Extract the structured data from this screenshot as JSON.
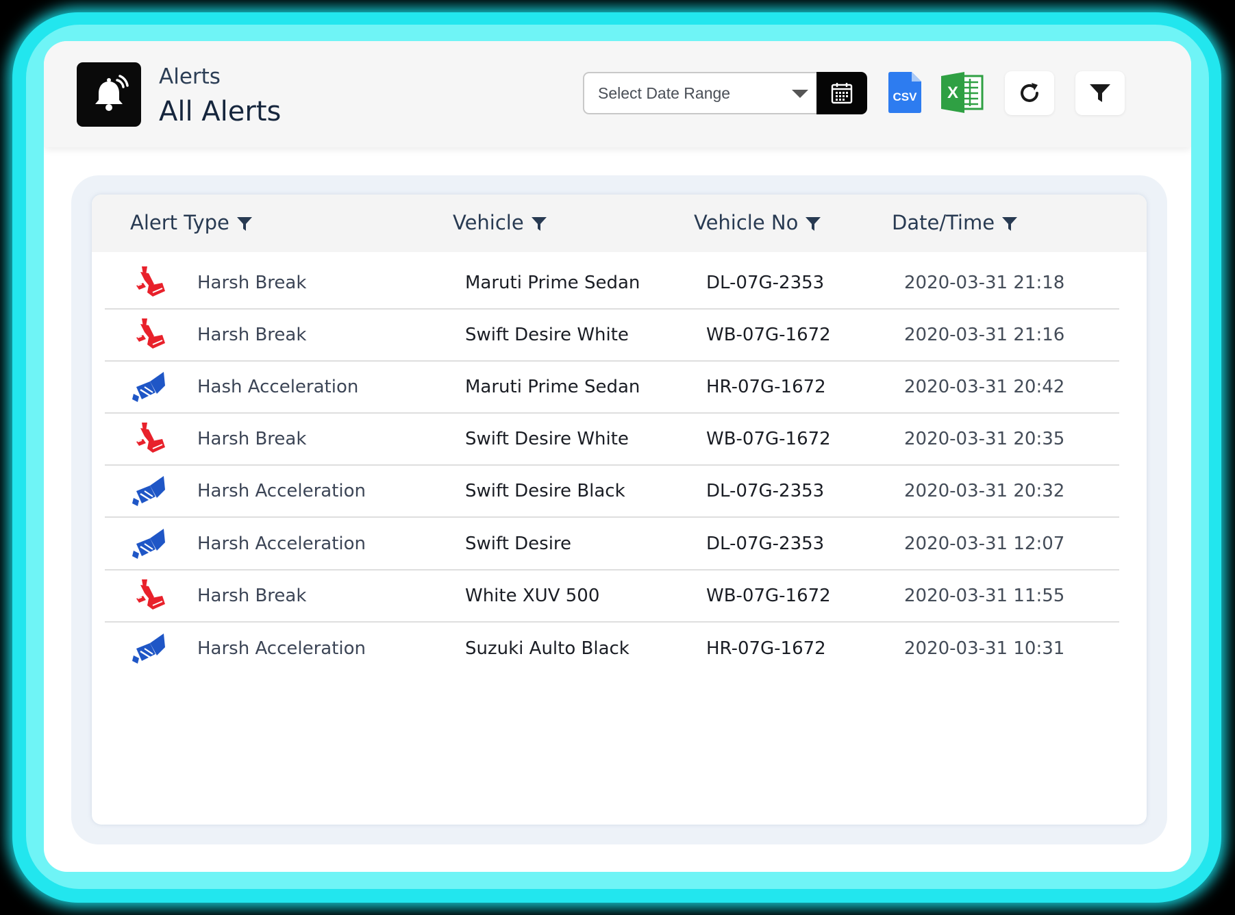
{
  "header": {
    "section_label": "Alerts",
    "page_title": "All Alerts",
    "date_range_placeholder": "Select Date Range",
    "csv_label": "CSV",
    "excel_label": "X"
  },
  "icons": {
    "bell": "bell-ring-icon",
    "calendar": "calendar-icon",
    "csv": "csv-file-icon",
    "excel": "excel-file-icon",
    "refresh": "refresh-icon",
    "filter": "filter-icon",
    "harsh_break": "brake-pedal-icon",
    "harsh_acceleration": "accelerator-pedal-icon"
  },
  "colors": {
    "glow": "#22e6ee",
    "brake_icon": "#e8212b",
    "accel_icon": "#1f56c6",
    "csv_blue": "#2d7cf0",
    "excel_green": "#2fa043"
  },
  "table": {
    "columns": [
      "Alert Type",
      "Vehicle",
      "Vehicle No",
      "Date/Time"
    ],
    "rows": [
      {
        "kind": "brake",
        "type": "Harsh Break",
        "vehicle": "Maruti Prime Sedan",
        "vehicle_no": "DL-07G-2353",
        "datetime": "2020-03-31 21:18"
      },
      {
        "kind": "brake",
        "type": "Harsh Break",
        "vehicle": "Swift Desire White",
        "vehicle_no": "WB-07G-1672",
        "datetime": "2020-03-31 21:16"
      },
      {
        "kind": "accel",
        "type": "Hash Acceleration",
        "vehicle": "Maruti Prime Sedan",
        "vehicle_no": "HR-07G-1672",
        "datetime": "2020-03-31 20:42"
      },
      {
        "kind": "brake",
        "type": "Harsh Break",
        "vehicle": "Swift Desire White",
        "vehicle_no": "WB-07G-1672",
        "datetime": "2020-03-31 20:35"
      },
      {
        "kind": "accel",
        "type": "Harsh Acceleration",
        "vehicle": "Swift Desire Black",
        "vehicle_no": "DL-07G-2353",
        "datetime": "2020-03-31 20:32"
      },
      {
        "kind": "accel",
        "type": "Harsh Acceleration",
        "vehicle": "Swift Desire",
        "vehicle_no": "DL-07G-2353",
        "datetime": "2020-03-31 12:07"
      },
      {
        "kind": "brake",
        "type": "Harsh Break",
        "vehicle": "White XUV 500",
        "vehicle_no": "WB-07G-1672",
        "datetime": "2020-03-31 11:55"
      },
      {
        "kind": "accel",
        "type": "Harsh Acceleration",
        "vehicle": "Suzuki Aulto Black",
        "vehicle_no": "HR-07G-1672",
        "datetime": "2020-03-31 10:31"
      }
    ]
  }
}
